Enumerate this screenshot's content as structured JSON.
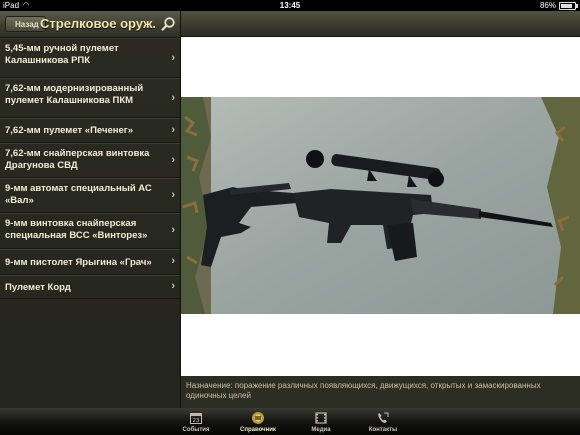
{
  "status_bar": {
    "carrier": "iPad",
    "time": "13:45",
    "battery": "86%"
  },
  "sidebar": {
    "back_label": "Назад",
    "title": "Стрелковое оруж...",
    "items": [
      {
        "label": "5,45-мм ручной пулемет Калашникова РПК"
      },
      {
        "label": "7,62-мм модернизированный пулемет Калашникова ПКМ"
      },
      {
        "label": "7,62-мм пулемет «Печенег»"
      },
      {
        "label": "7,62-мм снайперская винтовка Драгунова СВД"
      },
      {
        "label": "9-мм автомат специальный АС «Вал»"
      },
      {
        "label": "9-мм винтовка снайперская специальная ВСС «Винторез»"
      },
      {
        "label": "9-мм пистолет Ярыгина «Грач»"
      },
      {
        "label": "Пулемет Корд"
      }
    ]
  },
  "detail": {
    "description": "Назначение: поражение различных появляющихся, движущихся, открытых и замаскированных одиночных целей"
  },
  "tabbar": {
    "tabs": [
      {
        "label": "События",
        "icon": "calendar-icon"
      },
      {
        "label": "Справочник",
        "icon": "handbook-icon"
      },
      {
        "label": "Медиа",
        "icon": "film-icon"
      },
      {
        "label": "Контакты",
        "icon": "phone-icon"
      }
    ],
    "selected": "Справочник"
  }
}
